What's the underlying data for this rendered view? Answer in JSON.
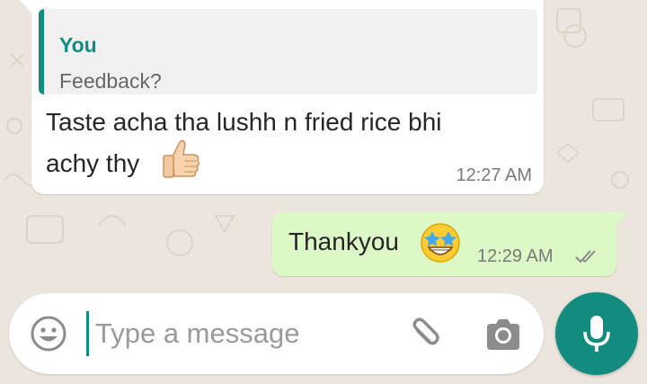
{
  "colors": {
    "wallpaper": "#ece5dd",
    "incoming_bubble": "#ffffff",
    "outgoing_bubble": "#dcf8c6",
    "accent": "#128c7e",
    "timestamp": "#7a7a7a"
  },
  "incoming_message": {
    "quoted_reply": {
      "author": "You",
      "text": "Feedback?"
    },
    "text_line_1": "Taste acha tha lushh n fried rice bhi",
    "text_line_2": "achy thy",
    "emoji": "thumbs-up-icon",
    "time": "12:27 AM"
  },
  "outgoing_message": {
    "text": "Thankyou",
    "emoji": "star-struck-icon",
    "time": "12:29 AM",
    "status": "read-double-tick-icon"
  },
  "composer": {
    "placeholder": "Type a message",
    "value": "",
    "emoji_button": "smiley-icon",
    "attach_button": "paperclip-icon",
    "camera_button": "camera-icon",
    "send_button": "microphone-icon"
  }
}
